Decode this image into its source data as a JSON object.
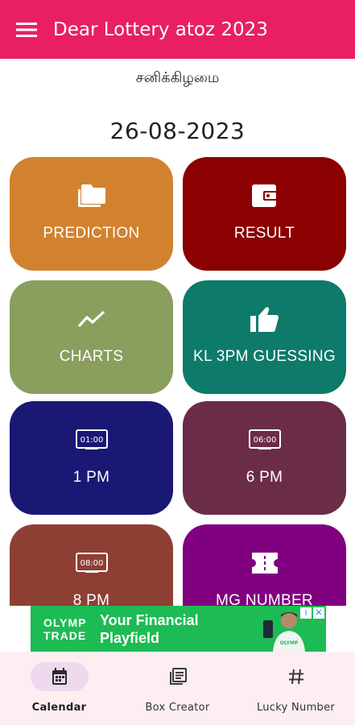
{
  "appbar": {
    "title": "Dear Lottery atoz 2023",
    "menu_icon": "menu-icon"
  },
  "day": "சனிக்கிழமை",
  "date": "26-08-2023",
  "tiles": [
    {
      "label": "PREDICTION",
      "icon": "folders-icon",
      "color": "#d2822f"
    },
    {
      "label": "RESULT",
      "icon": "wallet-icon",
      "color": "#8b0000"
    },
    {
      "label": "CHARTS",
      "icon": "trending-icon",
      "color": "#8a9e5e"
    },
    {
      "label": "KL 3PM GUESSING",
      "icon": "thumb-up-icon",
      "color": "#0d7a6a"
    },
    {
      "label": "1 PM",
      "icon": "clock-icon",
      "clock": "01:00",
      "color": "#1a1875"
    },
    {
      "label": "6 PM",
      "icon": "clock-icon",
      "clock": "06:00",
      "color": "#6b2c47"
    },
    {
      "label": "8 PM",
      "icon": "clock-icon",
      "clock": "08:00",
      "color": "#8e3f34"
    },
    {
      "label": "MG NUMBER",
      "icon": "ticket-icon",
      "color": "#800080"
    }
  ],
  "ad": {
    "brand_line1": "OLYMP",
    "brand_line2": "TRADE",
    "text_line1": "Your Financial",
    "text_line2": "Playfield",
    "color": "#1dbb53",
    "info": "i",
    "close": "✕"
  },
  "nav": [
    {
      "label": "Calendar",
      "icon": "calendar-icon",
      "active": true
    },
    {
      "label": "Box Creator",
      "icon": "list-box-icon",
      "active": false
    },
    {
      "label": "Lucky Number",
      "icon": "hash-icon",
      "active": false
    }
  ]
}
